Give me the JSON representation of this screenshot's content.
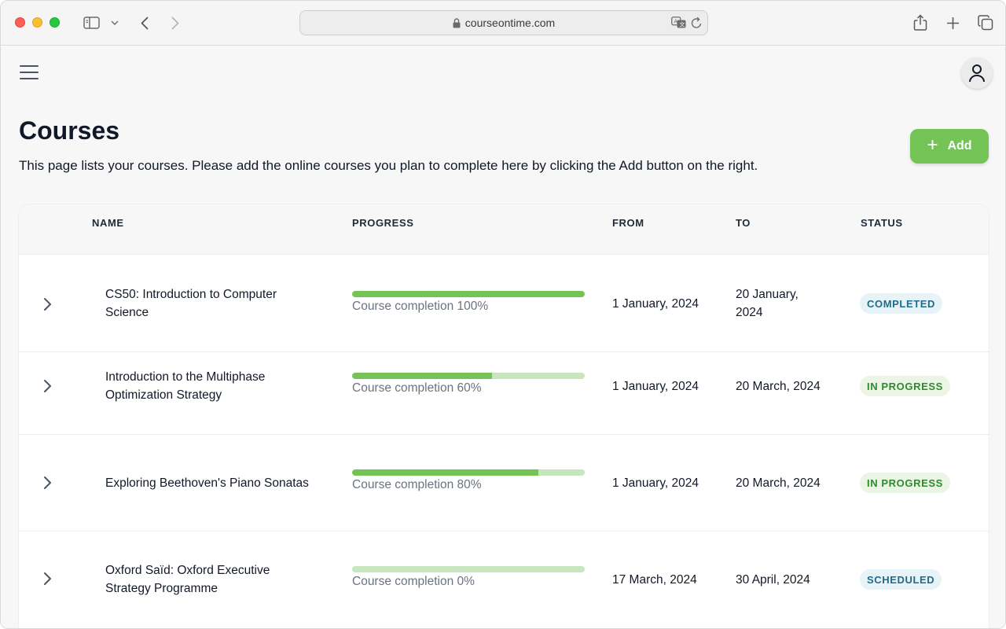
{
  "browser": {
    "url": "courseontime.com"
  },
  "page": {
    "title": "Courses",
    "description": "This page lists your courses. Please add the online courses you plan to complete here by clicking the Add button on the right.",
    "add_label": "Add"
  },
  "table": {
    "headers": {
      "name": "NAME",
      "progress": "PROGRESS",
      "from": "FROM",
      "to": "TO",
      "status": "STATUS"
    },
    "rows": [
      {
        "name_line1": "CS50: Introduction to Computer",
        "name_line2": "Science",
        "progress": 100,
        "progress_label": "Course completion 100%",
        "from": "1 January, 2024",
        "to_line1": "20 January,",
        "to_line2": "2024",
        "status": "COMPLETED"
      },
      {
        "name_line1": "Introduction to the Multiphase",
        "name_line2": "Optimization Strategy",
        "progress": 60,
        "progress_label": "Course completion 60%",
        "from": "1 January, 2024",
        "to_line1": "20 March, 2024",
        "to_line2": "",
        "status": "IN PROGRESS"
      },
      {
        "name_line1": "Exploring Beethoven's Piano Sonatas",
        "name_line2": "",
        "progress": 80,
        "progress_label": "Course completion 80%",
        "from": "1 January, 2024",
        "to_line1": "20 March, 2024",
        "to_line2": "",
        "status": "IN PROGRESS"
      },
      {
        "name_line1": "Oxford Saïd: Oxford Executive",
        "name_line2": "Strategy Programme",
        "progress": 0,
        "progress_label": "Course completion 0%",
        "from": "17 March, 2024",
        "to_line1": "30 April, 2024",
        "to_line2": "",
        "status": "SCHEDULED"
      }
    ]
  },
  "colors": {
    "accent": "#74c357",
    "progress_track": "#c8e6bd",
    "badge_completed_bg": "#e8f3f8",
    "badge_completed_text": "#1f6b8a",
    "badge_inprogress_bg": "#eaf5e6",
    "badge_inprogress_text": "#2f8a2f"
  },
  "icons": {
    "sidebar": "sidebar-icon",
    "menu": "hamburger-icon",
    "user": "user-icon",
    "row_expand": "chevron-right-icon"
  }
}
